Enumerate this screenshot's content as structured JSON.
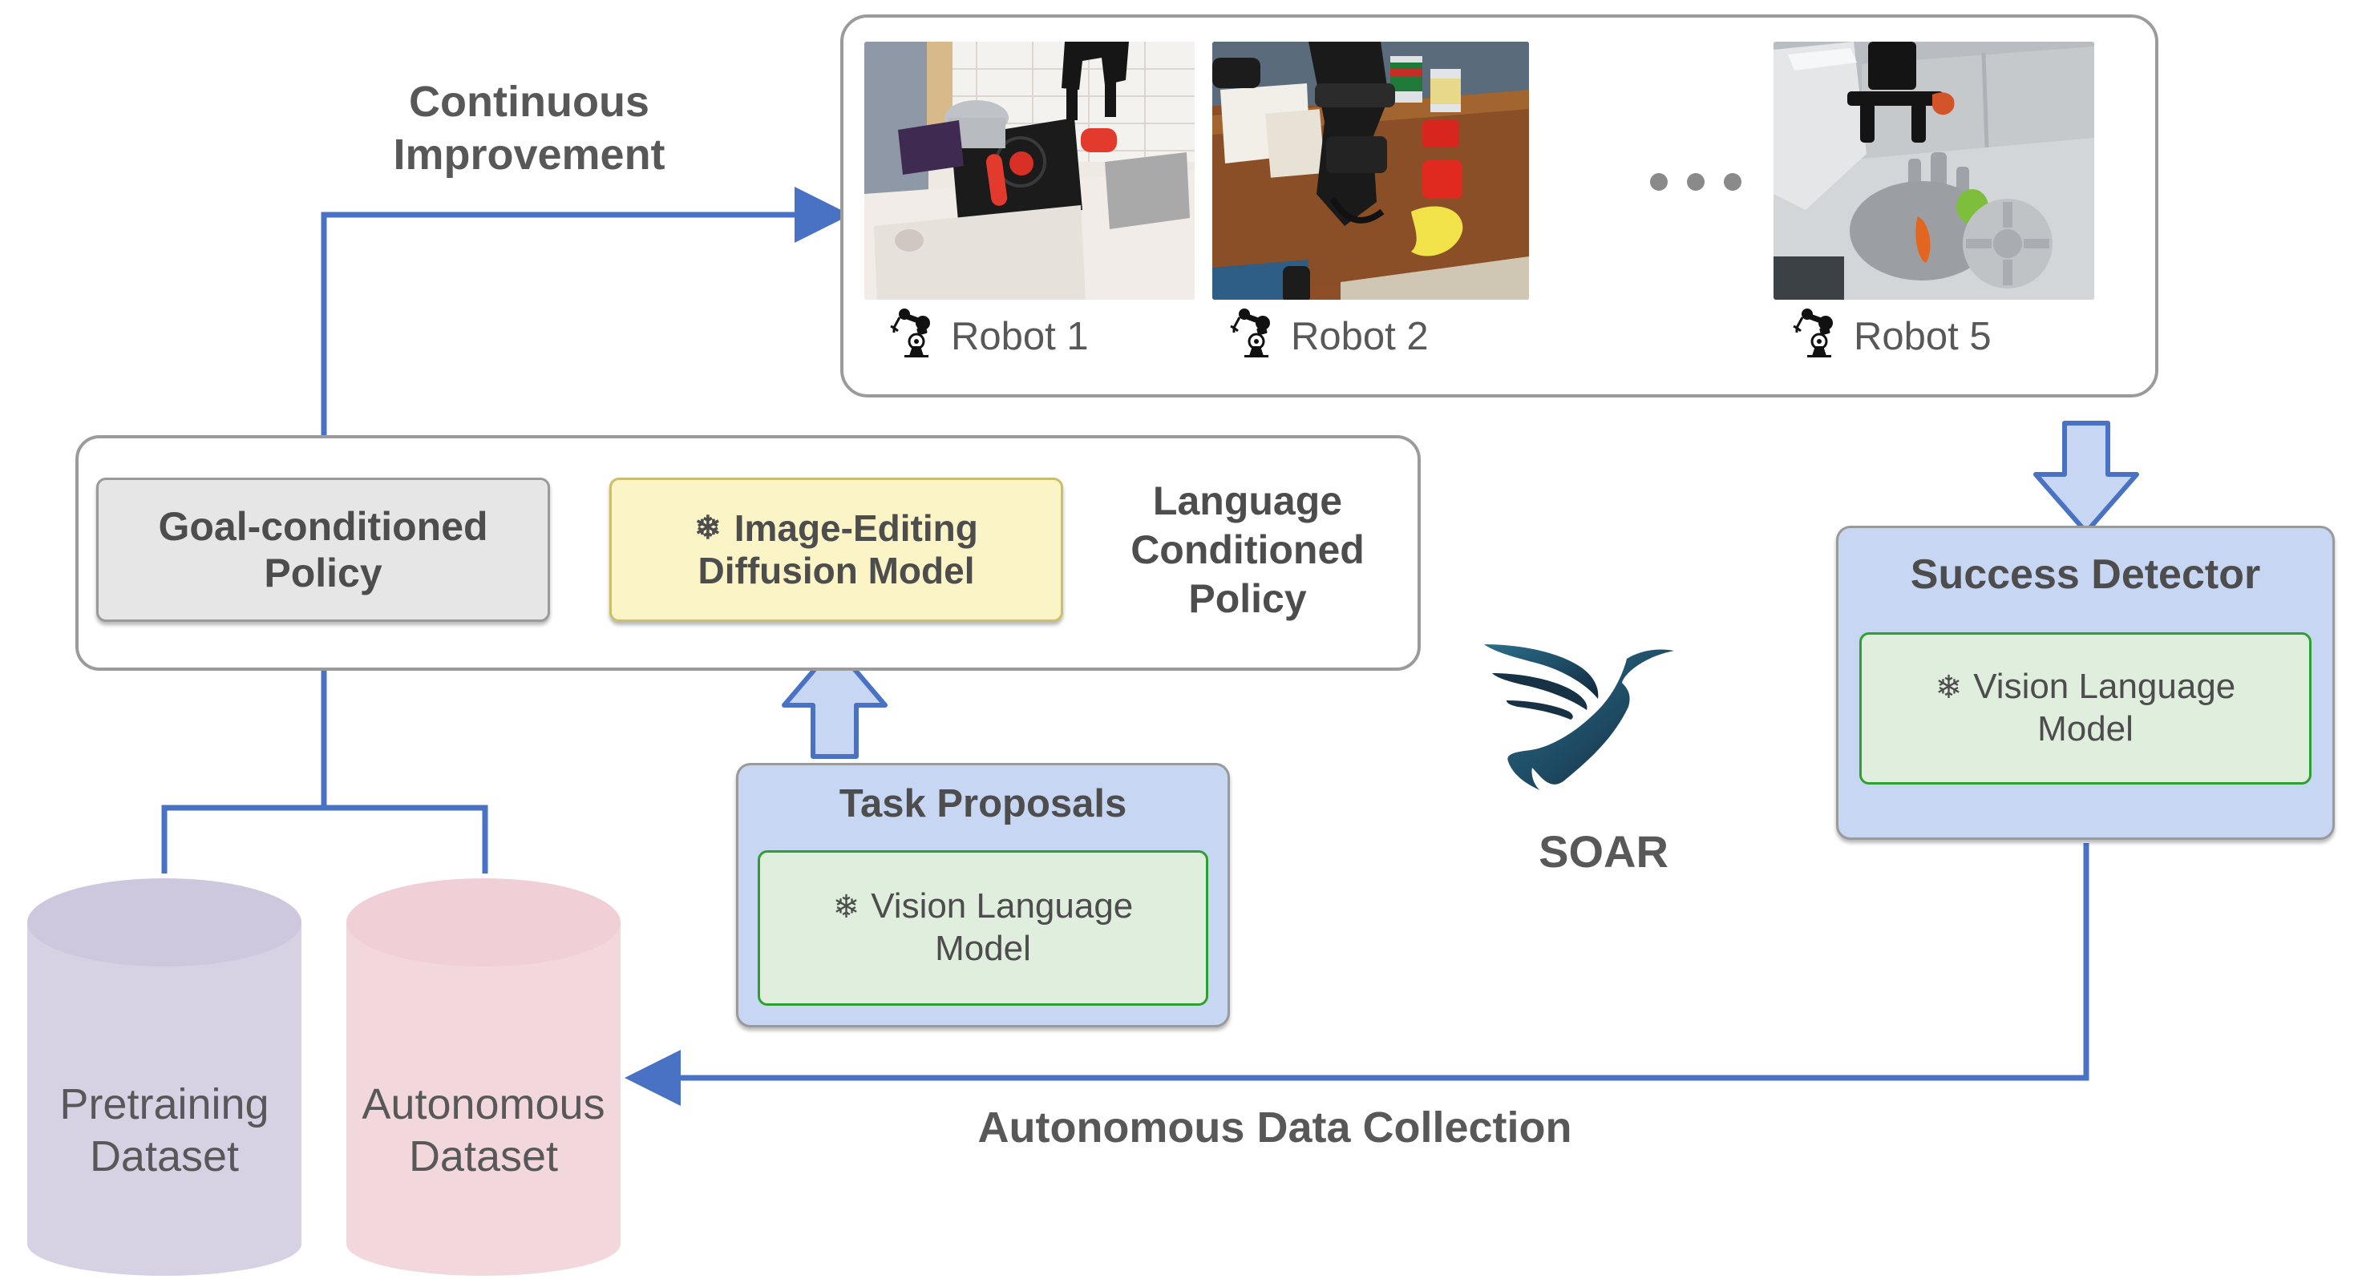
{
  "diagram": {
    "title": "SOAR autonomous improvement pipeline",
    "colors": {
      "blue_arrow": "#4a72c4",
      "blue_fill": "#c7d6f2",
      "yellow_fill": "#fbf4c6",
      "yellow_stroke": "#cbbf6a",
      "green_stroke": "#2fa02f",
      "green_fill": "#dfeedd",
      "grey_fill": "#e6e6e6",
      "grey_stroke": "#9b9b9b",
      "text_grey": "#4d4d4d",
      "pretraining_db": "#d6d2e4",
      "autonomous_db": "#f2d7dc",
      "soar_logo": "#1b3349"
    }
  },
  "robots_panel": {
    "items": [
      {
        "label": "Robot 1",
        "icon": "robot-arm-icon",
        "scene": "toy kitchen with pot on stove, purple towel and red utensil"
      },
      {
        "label": "Robot 2",
        "icon": "robot-arm-icon",
        "scene": "wooden table with cans, red blocks and a banana"
      },
      {
        "label": "Robot 5",
        "icon": "robot-arm-icon",
        "scene": "grey toy kitchen with sink, carrot and burner"
      }
    ],
    "ellipsis": "• • •"
  },
  "language_conditioned_policy": {
    "label": "Language\nConditioned\nPolicy",
    "label_lines": [
      "Language",
      "Conditioned",
      "Policy"
    ],
    "goal_conditioned_policy": {
      "label_lines": [
        "Goal-conditioned",
        "Policy"
      ]
    },
    "image_editing_diffusion_model": {
      "frozen_icon": "snowflake-icon",
      "label_lines": [
        "Image-Editing",
        "Diffusion Model"
      ]
    }
  },
  "task_proposals": {
    "title": "Task Proposals",
    "model": {
      "frozen_icon": "snowflake-icon",
      "label_lines": [
        "Vision Language",
        "Model"
      ]
    }
  },
  "success_detector": {
    "title": "Success Detector",
    "model": {
      "frozen_icon": "snowflake-icon",
      "label_lines": [
        "Vision Language",
        "Model"
      ]
    }
  },
  "datasets": [
    {
      "name": "pretraining-dataset",
      "label_lines": [
        "Pretraining",
        "Dataset"
      ],
      "color": "#d6d2e4"
    },
    {
      "name": "autonomous-dataset",
      "label_lines": [
        "Autonomous",
        "Dataset"
      ],
      "color": "#f2d7dc"
    }
  ],
  "edges": {
    "continuous_improvement": "Continuous\nImprovement",
    "continuous_improvement_lines": [
      "Continuous",
      "Improvement"
    ],
    "autonomous_data_collection": "Autonomous Data Collection"
  },
  "brand": {
    "name": "SOAR",
    "logo": "soar-bird-logo"
  }
}
